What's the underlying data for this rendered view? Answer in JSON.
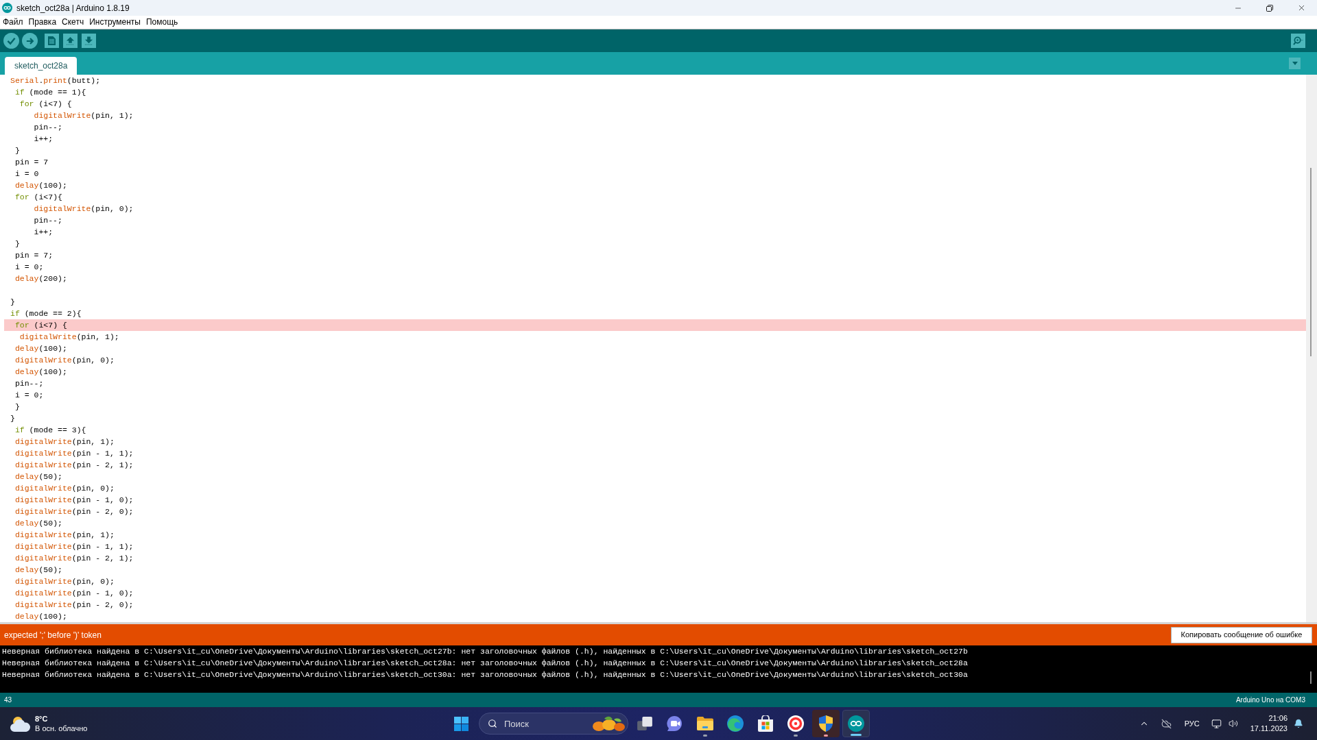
{
  "window": {
    "title": "sketch_oct28a | Arduino 1.8.19"
  },
  "menu": [
    "Файл",
    "Правка",
    "Скетч",
    "Инструменты",
    "Помощь"
  ],
  "tabs": [
    {
      "label": "sketch_oct28a",
      "selected": true
    }
  ],
  "editor": {
    "lines": [
      {
        "error": false,
        "tokens": [
          {
            "kind": "function",
            "text": "Serial"
          },
          {
            "kind": "plain",
            "text": "."
          },
          {
            "kind": "function",
            "text": "print"
          },
          {
            "kind": "plain",
            "text": "(butt);"
          }
        ]
      },
      {
        "error": false,
        "tokens": [
          {
            "kind": "keyword",
            "text": " if"
          },
          {
            "kind": "plain",
            "text": " (mode == 1){"
          }
        ]
      },
      {
        "error": false,
        "tokens": [
          {
            "kind": "keyword",
            "text": "  for"
          },
          {
            "kind": "plain",
            "text": " (i<7) {"
          }
        ]
      },
      {
        "error": false,
        "tokens": [
          {
            "kind": "function",
            "text": "     digitalWrite"
          },
          {
            "kind": "plain",
            "text": "(pin, 1);"
          }
        ]
      },
      {
        "error": false,
        "tokens": [
          {
            "kind": "plain",
            "text": "     pin--;"
          }
        ]
      },
      {
        "error": false,
        "tokens": [
          {
            "kind": "plain",
            "text": "     i++;"
          }
        ]
      },
      {
        "error": false,
        "tokens": [
          {
            "kind": "plain",
            "text": " }"
          }
        ]
      },
      {
        "error": false,
        "tokens": [
          {
            "kind": "plain",
            "text": " pin = 7"
          }
        ]
      },
      {
        "error": false,
        "tokens": [
          {
            "kind": "plain",
            "text": " i = 0"
          }
        ]
      },
      {
        "error": false,
        "tokens": [
          {
            "kind": "function",
            "text": " delay"
          },
          {
            "kind": "plain",
            "text": "(100);"
          }
        ]
      },
      {
        "error": false,
        "tokens": [
          {
            "kind": "keyword",
            "text": " for"
          },
          {
            "kind": "plain",
            "text": " (i<7){"
          }
        ]
      },
      {
        "error": false,
        "tokens": [
          {
            "kind": "function",
            "text": "     digitalWrite"
          },
          {
            "kind": "plain",
            "text": "(pin, 0);"
          }
        ]
      },
      {
        "error": false,
        "tokens": [
          {
            "kind": "plain",
            "text": "     pin--;"
          }
        ]
      },
      {
        "error": false,
        "tokens": [
          {
            "kind": "plain",
            "text": "     i++;"
          }
        ]
      },
      {
        "error": false,
        "tokens": [
          {
            "kind": "plain",
            "text": " }"
          }
        ]
      },
      {
        "error": false,
        "tokens": [
          {
            "kind": "plain",
            "text": " pin = 7;"
          }
        ]
      },
      {
        "error": false,
        "tokens": [
          {
            "kind": "plain",
            "text": " i = 0;"
          }
        ]
      },
      {
        "error": false,
        "tokens": [
          {
            "kind": "function",
            "text": " delay"
          },
          {
            "kind": "plain",
            "text": "(200);"
          }
        ]
      },
      {
        "error": false
      },
      {
        "error": false,
        "tokens": [
          {
            "kind": "plain",
            "text": "}"
          }
        ]
      },
      {
        "error": false,
        "tokens": [
          {
            "kind": "keyword",
            "text": "if"
          },
          {
            "kind": "plain",
            "text": " (mode == 2){"
          }
        ]
      },
      {
        "error": true,
        "tokens": [
          {
            "kind": "keyword",
            "text": " for"
          },
          {
            "kind": "plain",
            "text": " (i<7) {"
          }
        ]
      },
      {
        "error": false,
        "tokens": [
          {
            "kind": "function",
            "text": "  digitalWrite"
          },
          {
            "kind": "plain",
            "text": "(pin, 1);"
          }
        ]
      },
      {
        "error": false,
        "tokens": [
          {
            "kind": "function",
            "text": " delay"
          },
          {
            "kind": "plain",
            "text": "(100);"
          }
        ]
      },
      {
        "error": false,
        "tokens": [
          {
            "kind": "function",
            "text": " digitalWrite"
          },
          {
            "kind": "plain",
            "text": "(pin, 0);"
          }
        ]
      },
      {
        "error": false,
        "tokens": [
          {
            "kind": "function",
            "text": " delay"
          },
          {
            "kind": "plain",
            "text": "(100);"
          }
        ]
      },
      {
        "error": false,
        "tokens": [
          {
            "kind": "plain",
            "text": " pin--;"
          }
        ]
      },
      {
        "error": false,
        "tokens": [
          {
            "kind": "plain",
            "text": " i = 0;"
          }
        ]
      },
      {
        "error": false,
        "tokens": [
          {
            "kind": "plain",
            "text": " }"
          }
        ]
      },
      {
        "error": false,
        "tokens": [
          {
            "kind": "plain",
            "text": "}"
          }
        ]
      },
      {
        "error": false,
        "tokens": [
          {
            "kind": "keyword",
            "text": " if"
          },
          {
            "kind": "plain",
            "text": " (mode == 3){"
          }
        ]
      },
      {
        "error": false,
        "tokens": [
          {
            "kind": "function",
            "text": " digitalWrite"
          },
          {
            "kind": "plain",
            "text": "(pin, 1);"
          }
        ]
      },
      {
        "error": false,
        "tokens": [
          {
            "kind": "function",
            "text": " digitalWrite"
          },
          {
            "kind": "plain",
            "text": "(pin - 1, 1);"
          }
        ]
      },
      {
        "error": false,
        "tokens": [
          {
            "kind": "function",
            "text": " digitalWrite"
          },
          {
            "kind": "plain",
            "text": "(pin - 2, 1);"
          }
        ]
      },
      {
        "error": false,
        "tokens": [
          {
            "kind": "function",
            "text": " delay"
          },
          {
            "kind": "plain",
            "text": "(50);"
          }
        ]
      },
      {
        "error": false,
        "tokens": [
          {
            "kind": "function",
            "text": " digitalWrite"
          },
          {
            "kind": "plain",
            "text": "(pin, 0);"
          }
        ]
      },
      {
        "error": false,
        "tokens": [
          {
            "kind": "function",
            "text": " digitalWrite"
          },
          {
            "kind": "plain",
            "text": "(pin - 1, 0);"
          }
        ]
      },
      {
        "error": false,
        "tokens": [
          {
            "kind": "function",
            "text": " digitalWrite"
          },
          {
            "kind": "plain",
            "text": "(pin - 2, 0);"
          }
        ]
      },
      {
        "error": false,
        "tokens": [
          {
            "kind": "function",
            "text": " delay"
          },
          {
            "kind": "plain",
            "text": "(50);"
          }
        ]
      },
      {
        "error": false,
        "tokens": [
          {
            "kind": "function",
            "text": " digitalWrite"
          },
          {
            "kind": "plain",
            "text": "(pin, 1);"
          }
        ]
      },
      {
        "error": false,
        "tokens": [
          {
            "kind": "function",
            "text": " digitalWrite"
          },
          {
            "kind": "plain",
            "text": "(pin - 1, 1);"
          }
        ]
      },
      {
        "error": false,
        "tokens": [
          {
            "kind": "function",
            "text": " digitalWrite"
          },
          {
            "kind": "plain",
            "text": "(pin - 2, 1);"
          }
        ]
      },
      {
        "error": false,
        "tokens": [
          {
            "kind": "function",
            "text": " delay"
          },
          {
            "kind": "plain",
            "text": "(50);"
          }
        ]
      },
      {
        "error": false,
        "tokens": [
          {
            "kind": "function",
            "text": " digitalWrite"
          },
          {
            "kind": "plain",
            "text": "(pin, 0);"
          }
        ]
      },
      {
        "error": false,
        "tokens": [
          {
            "kind": "function",
            "text": " digitalWrite"
          },
          {
            "kind": "plain",
            "text": "(pin - 1, 0);"
          }
        ]
      },
      {
        "error": false,
        "tokens": [
          {
            "kind": "function",
            "text": " digitalWrite"
          },
          {
            "kind": "plain",
            "text": "(pin - 2, 0);"
          }
        ]
      },
      {
        "error": false,
        "tokens": [
          {
            "kind": "function",
            "text": " delay"
          },
          {
            "kind": "plain",
            "text": "(100);"
          }
        ]
      }
    ]
  },
  "error_bar": {
    "message": "expected ';' before ')' token",
    "copy_button": "Копировать сообщение об ошибке"
  },
  "console": {
    "lines": [
      "Неверная библиотека найдена в C:\\Users\\it_cu\\OneDrive\\Документы\\Arduino\\libraries\\sketch_oct27b: нет заголовочных файлов (.h), найденных в C:\\Users\\it_cu\\OneDrive\\Документы\\Arduino\\libraries\\sketch_oct27b",
      "Неверная библиотека найдена в C:\\Users\\it_cu\\OneDrive\\Документы\\Arduino\\libraries\\sketch_oct28a: нет заголовочных файлов (.h), найденных в C:\\Users\\it_cu\\OneDrive\\Документы\\Arduino\\libraries\\sketch_oct28a",
      "Неверная библиотека найдена в C:\\Users\\it_cu\\OneDrive\\Документы\\Arduino\\libraries\\sketch_oct30a: нет заголовочных файлов (.h), найденных в C:\\Users\\it_cu\\OneDrive\\Документы\\Arduino\\libraries\\sketch_oct30a"
    ]
  },
  "status_bar": {
    "line_number": "43",
    "board": "Arduino Uno на COM3"
  },
  "taskbar": {
    "weather": {
      "temperature": "8°C",
      "condition": "В осн. облачно"
    },
    "search": {
      "placeholder": "Поиск"
    },
    "apps": [
      {
        "kind": "task_view",
        "running": false,
        "active": false,
        "attention": false
      },
      {
        "kind": "chat",
        "running": false,
        "active": false,
        "attention": false
      },
      {
        "kind": "file_explorer",
        "running": true,
        "active": false,
        "attention": false
      },
      {
        "kind": "edge",
        "running": false,
        "active": false,
        "attention": false
      },
      {
        "kind": "store",
        "running": false,
        "active": false,
        "attention": false
      },
      {
        "kind": "yandex_browser",
        "running": true,
        "active": false,
        "attention": false
      },
      {
        "kind": "security_shield",
        "running": true,
        "active": false,
        "attention": true
      },
      {
        "kind": "arduino",
        "running": true,
        "active": true,
        "attention": false
      }
    ],
    "language": "РУС",
    "time": "21:06",
    "date": "17.11.2023"
  }
}
